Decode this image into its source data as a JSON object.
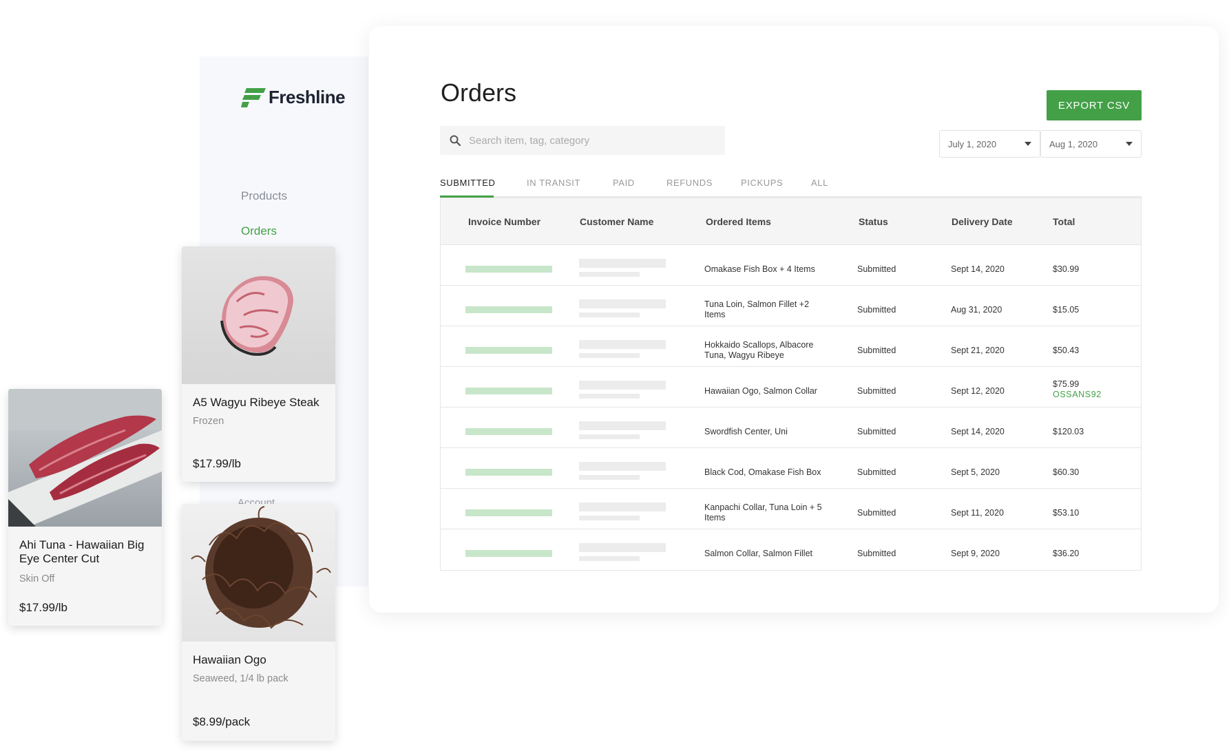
{
  "brand": {
    "name": "Freshline",
    "accent": "#43a047"
  },
  "sidebar": {
    "items": [
      {
        "label": "Products",
        "active": false
      },
      {
        "label": "Orders",
        "active": true
      },
      {
        "label": "Account",
        "active": false
      }
    ]
  },
  "page": {
    "title": "Orders",
    "export_label": "EXPORT CSV",
    "search_placeholder": "Search item, tag, category",
    "date_from": "July 1, 2020",
    "date_to": "Aug 1, 2020"
  },
  "tabs": [
    "SUBMITTED",
    "IN TRANSIT",
    "PAID",
    "REFUNDS",
    "PICKUPS",
    "ALL"
  ],
  "table": {
    "columns": [
      "Invoice Number",
      "Customer Name",
      "Ordered Items",
      "Status",
      "Delivery Date",
      "Total"
    ],
    "rows": [
      {
        "items": "Omakase Fish Box + 4 Items",
        "status": "Submitted",
        "date": "Sept 14, 2020",
        "total": "$30.99",
        "promo": ""
      },
      {
        "items": "Tuna Loin, Salmon Fillet +2 Items",
        "status": "Submitted",
        "date": "Aug 31, 2020",
        "total": "$15.05",
        "promo": ""
      },
      {
        "items": "Hokkaido Scallops, Albacore Tuna, Wagyu Ribeye",
        "status": "Submitted",
        "date": "Sept 21, 2020",
        "total": "$50.43",
        "promo": ""
      },
      {
        "items": "Hawaiian Ogo, Salmon Collar",
        "status": "Submitted",
        "date": "Sept 12, 2020",
        "total": "$75.99",
        "promo": "OSSANS92"
      },
      {
        "items": "Swordfish Center, Uni",
        "status": "Submitted",
        "date": "Sept 14, 2020",
        "total": "$120.03",
        "promo": ""
      },
      {
        "items": "Black Cod, Omakase Fish Box",
        "status": "Submitted",
        "date": "Sept 5, 2020",
        "total": "$60.30",
        "promo": ""
      },
      {
        "items": "Kanpachi Collar, Tuna Loin + 5 Items",
        "status": "Submitted",
        "date": "Sept 11, 2020",
        "total": "$53.10",
        "promo": ""
      },
      {
        "items": "Salmon Collar, Salmon Fillet",
        "status": "Submitted",
        "date": "Sept 9, 2020",
        "total": "$36.20",
        "promo": ""
      }
    ]
  },
  "cards": [
    {
      "name": "A5 Wagyu Ribeye Steak",
      "sub": "Frozen",
      "price": "$17.99/lb"
    },
    {
      "name": "Ahi Tuna - Hawaiian Big Eye Center Cut",
      "sub": "Skin Off",
      "price": "$17.99/lb"
    },
    {
      "name": "Hawaiian Ogo",
      "sub": "Seaweed, 1/4 lb pack",
      "price": "$8.99/pack"
    }
  ]
}
